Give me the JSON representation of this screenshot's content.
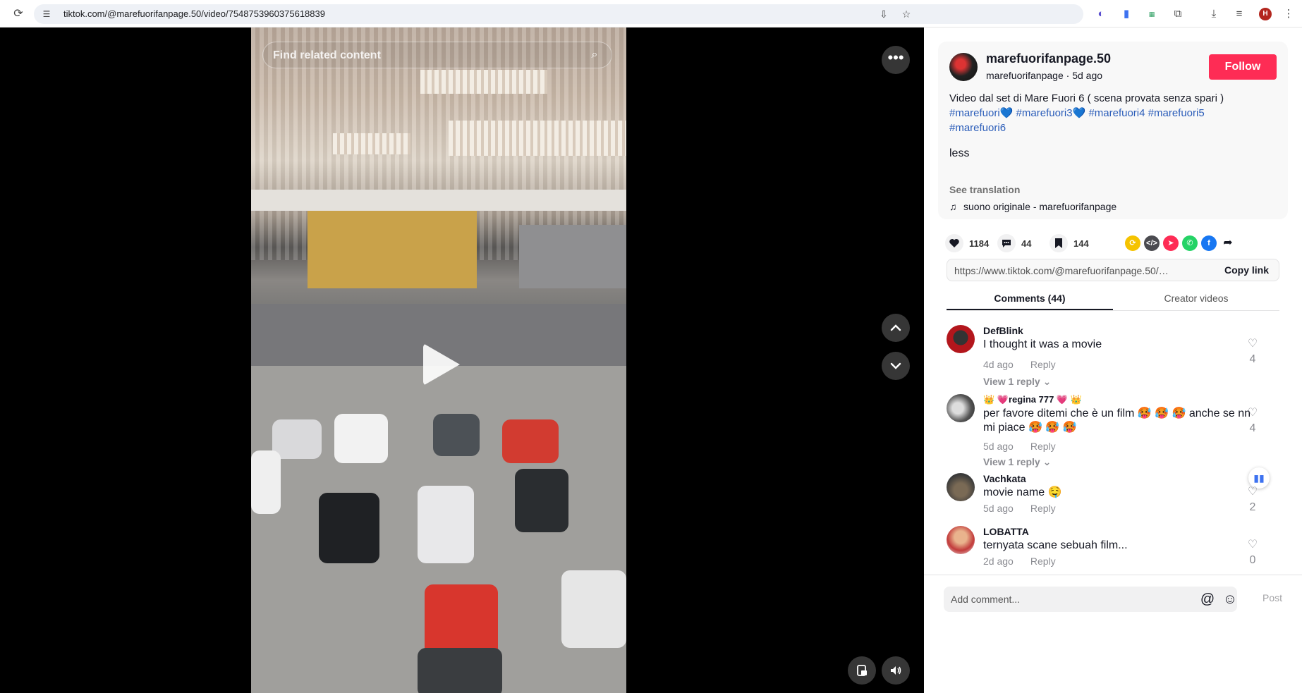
{
  "browser": {
    "url": "tiktok.com/@marefuorifanpage.50/video/7548753960375618839",
    "profile_initial": "H"
  },
  "video": {
    "search_placeholder": "Find related content"
  },
  "author": {
    "display_name": "marefuorifanpage.50",
    "handle": "marefuorifanpage",
    "separator": " · ",
    "posted": "5d ago",
    "follow_label": "Follow"
  },
  "description": {
    "text": "Video dal set di Mare Fuori 6 ( scena provata senza spari )",
    "hashtags": [
      "#marefuori💙",
      "#marefuori3💙",
      "#marefuori4",
      "#marefuori5",
      "#marefuori6"
    ],
    "less_label": "less",
    "see_translation": "See translation",
    "music": "suono originale - marefuorifanpage"
  },
  "stats": {
    "likes": "1184",
    "comments": "44",
    "saves": "144"
  },
  "share": {
    "link": "https://www.tiktok.com/@marefuorifanpage.50/video...",
    "copy_label": "Copy link"
  },
  "tabs": {
    "comments": "Comments (44)",
    "creator_videos": "Creator videos"
  },
  "comments": [
    {
      "name": "DefBlink",
      "text": "I thought it was a movie",
      "time": "4d ago",
      "reply": "Reply",
      "view_replies": "View 1 reply",
      "likes": "4"
    },
    {
      "name": "👑 💗regina 777 💗 👑",
      "text": "per favore ditemi che è un film 🥵 🥵 🥵 anche se nn mi piace 🥵 🥵 🥵",
      "time": "5d ago",
      "reply": "Reply",
      "view_replies": "View 1 reply",
      "likes": "4"
    },
    {
      "name": "Vachkata",
      "text": "movie name 🤤",
      "time": "5d ago",
      "reply": "Reply",
      "likes": "2"
    },
    {
      "name": "LOBATTA",
      "text": "ternyata scane sebuah film...",
      "time": "2d ago",
      "reply": "Reply",
      "likes": "0"
    }
  ],
  "comment_box": {
    "placeholder": "Add comment...",
    "post_label": "Post"
  },
  "colors": {
    "accent": "#fe2c55",
    "hashtag": "#2b5db9"
  }
}
